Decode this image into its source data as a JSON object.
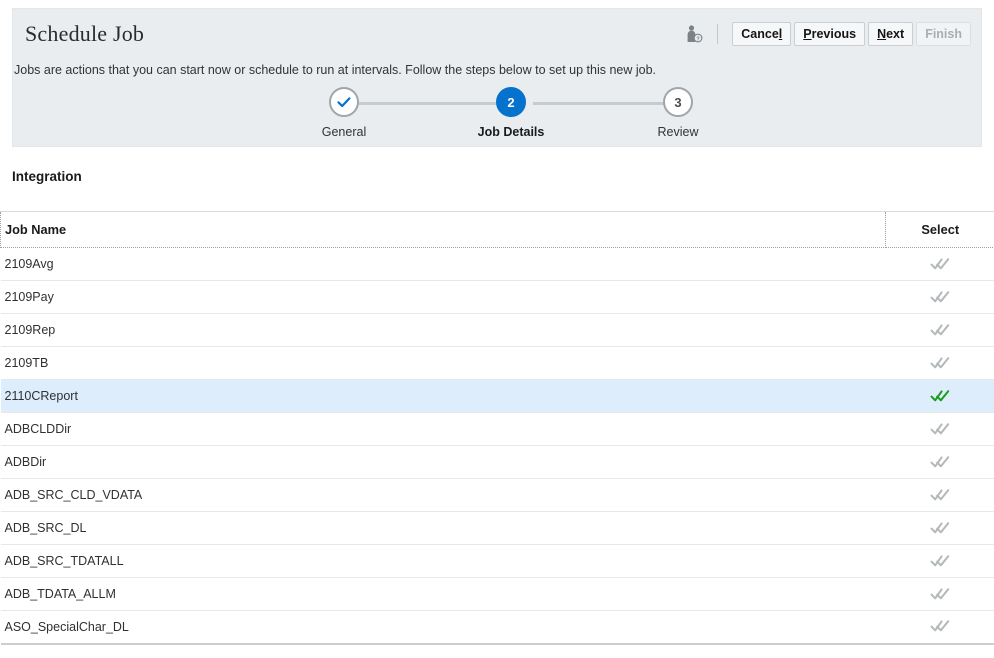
{
  "header": {
    "title": "Schedule Job",
    "description": "Jobs are actions that you can start now or schedule to run at intervals. Follow the steps below to set up this new job.",
    "help_icon": "person-question-icon"
  },
  "toolbar": {
    "buttons": [
      {
        "label": "Cancel",
        "accel_index": 5,
        "disabled": false,
        "name": "cancel-button"
      },
      {
        "label": "Previous",
        "accel_index": 0,
        "disabled": false,
        "name": "previous-button"
      },
      {
        "label": "Next",
        "accel_index": 0,
        "disabled": false,
        "name": "next-button"
      },
      {
        "label": "Finish",
        "accel_index": -1,
        "disabled": true,
        "name": "finish-button"
      }
    ]
  },
  "steps": {
    "items": [
      {
        "number": "1",
        "label": "General",
        "state": "done",
        "marker": "check"
      },
      {
        "number": "2",
        "label": "Job Details",
        "state": "current",
        "marker": "number"
      },
      {
        "number": "3",
        "label": "Review",
        "state": "upcoming",
        "marker": "number"
      }
    ]
  },
  "section": {
    "title": "Integration"
  },
  "table": {
    "columns": [
      {
        "label": "Job Name",
        "name": "column-job-name"
      },
      {
        "label": "Select",
        "name": "column-select"
      }
    ],
    "rows": [
      {
        "job_name": "2109Avg",
        "selected": false
      },
      {
        "job_name": "2109Pay",
        "selected": false
      },
      {
        "job_name": "2109Rep",
        "selected": false
      },
      {
        "job_name": "2109TB",
        "selected": false
      },
      {
        "job_name": "2110CReport",
        "selected": true
      },
      {
        "job_name": "ADBCLDDir",
        "selected": false
      },
      {
        "job_name": "ADBDir",
        "selected": false
      },
      {
        "job_name": "ADB_SRC_CLD_VDATA",
        "selected": false
      },
      {
        "job_name": "ADB_SRC_DL",
        "selected": false
      },
      {
        "job_name": "ADB_SRC_TDATALL",
        "selected": false
      },
      {
        "job_name": "ADB_TDATA_ALLM",
        "selected": false
      },
      {
        "job_name": "ASO_SpecialChar_DL",
        "selected": false
      }
    ]
  },
  "colors": {
    "panel_bg": "#e9edef",
    "accent_blue": "#0572ce",
    "selected_row": "#ddedfb",
    "check_selected": "#1a9e1a",
    "check_unselected": "#b3b8bb"
  },
  "icons": {
    "check_selected": "double-check-icon",
    "check_unselected": "double-check-icon"
  }
}
